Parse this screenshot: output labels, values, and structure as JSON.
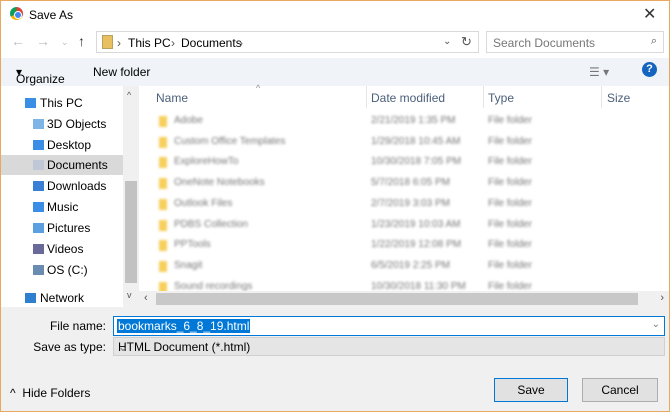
{
  "window": {
    "title": "Save As"
  },
  "address": {
    "crumbs": [
      "This PC",
      "Documents"
    ]
  },
  "search": {
    "placeholder": "Search Documents"
  },
  "toolbar": {
    "organize": "Organize",
    "new_folder": "New folder",
    "help": "?"
  },
  "sidebar": {
    "items": [
      {
        "label": "This PC",
        "icon": "computer-icon"
      },
      {
        "label": "3D Objects",
        "icon": "cube-icon"
      },
      {
        "label": "Desktop",
        "icon": "desktop-icon"
      },
      {
        "label": "Documents",
        "icon": "document-icon",
        "selected": true
      },
      {
        "label": "Downloads",
        "icon": "download-icon"
      },
      {
        "label": "Music",
        "icon": "music-icon"
      },
      {
        "label": "Pictures",
        "icon": "picture-icon"
      },
      {
        "label": "Videos",
        "icon": "video-icon"
      },
      {
        "label": "OS (C:)",
        "icon": "drive-icon"
      },
      {
        "label": "Network",
        "icon": "network-icon"
      }
    ]
  },
  "columns": [
    "Name",
    "Date modified",
    "Type",
    "Size"
  ],
  "files": [
    {
      "name": "Adobe",
      "date": "2/21/2019 1:35 PM",
      "type": "File folder"
    },
    {
      "name": "Custom Office Templates",
      "date": "1/29/2018 10:45 AM",
      "type": "File folder"
    },
    {
      "name": "ExploreHowTo",
      "date": "10/30/2018 7:05 PM",
      "type": "File folder"
    },
    {
      "name": "OneNote Notebooks",
      "date": "5/7/2018 6:05 PM",
      "type": "File folder"
    },
    {
      "name": "Outlook Files",
      "date": "2/7/2019 3:03 PM",
      "type": "File folder"
    },
    {
      "name": "PDBS Collection",
      "date": "1/23/2019 10:03 AM",
      "type": "File folder"
    },
    {
      "name": "PPTools",
      "date": "1/22/2019 12:08 PM",
      "type": "File folder"
    },
    {
      "name": "Snagit",
      "date": "6/5/2019 2:25 PM",
      "type": "File folder"
    },
    {
      "name": "Sound recordings",
      "date": "10/30/2018 11:30 PM",
      "type": "File folder"
    }
  ],
  "form": {
    "file_name_label": "File name:",
    "file_name": "bookmarks_6_8_19.html",
    "type_label": "Save as type:",
    "type_value": "HTML Document (*.html)"
  },
  "footer": {
    "hide_folders": "Hide Folders",
    "save": "Save",
    "cancel": "Cancel"
  }
}
